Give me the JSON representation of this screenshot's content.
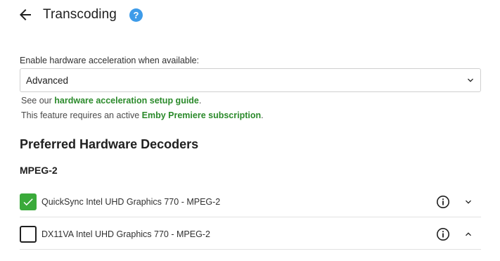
{
  "header": {
    "title": "Transcoding",
    "help_symbol": "?",
    "back_icon": "arrow-left-icon",
    "help_icon": "question-icon"
  },
  "hardware_acceleration": {
    "label": "Enable hardware acceleration when available:",
    "selected": "Advanced",
    "chevron_icon": "chevron-down-icon"
  },
  "notes": {
    "setup_prefix": "See our ",
    "setup_link": "hardware acceleration setup guide",
    "setup_suffix": ".",
    "premiere_prefix": "This feature requires an active ",
    "premiere_link": "Emby Premiere subscription",
    "premiere_suffix": "."
  },
  "decoders": {
    "section_title": "Preferred Hardware Decoders",
    "group_title": "MPEG-2",
    "items": [
      {
        "label": "QuickSync Intel UHD Graphics 770 - MPEG-2",
        "checked": true,
        "expand_icon": "chevron-down-icon"
      },
      {
        "label": "DX11VA Intel UHD Graphics 770 - MPEG-2",
        "checked": false,
        "expand_icon": "chevron-up-icon"
      }
    ]
  },
  "colors": {
    "link": "#2b8a2b",
    "checkbox_checked": "#3aaa3a",
    "help_badge": "#3d9be9"
  }
}
